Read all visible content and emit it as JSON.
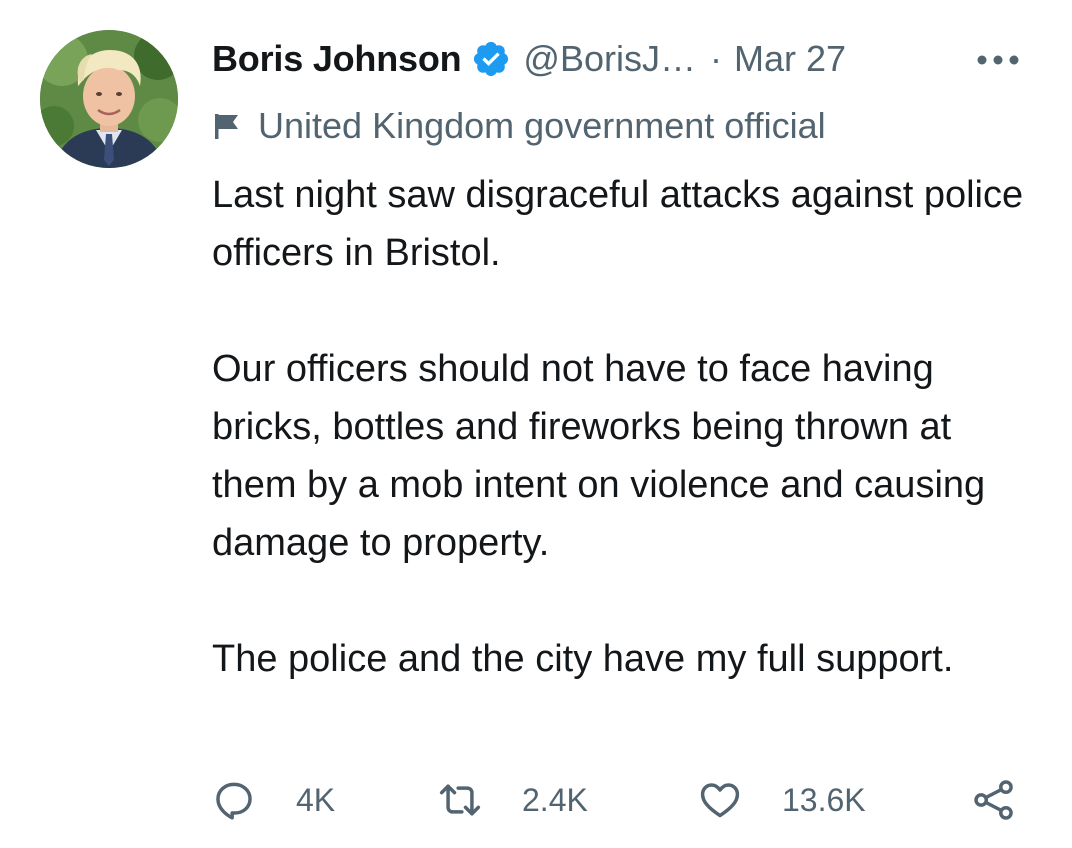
{
  "tweet": {
    "author": {
      "display_name": "Boris Johnson",
      "handle": "@BorisJ…",
      "verified": true
    },
    "separator": "·",
    "timestamp": "Mar 27",
    "label": "United Kingdom government official",
    "paragraphs": [
      "Last night saw disgraceful attacks against police officers in Bristol.",
      "Our officers should not have to face having bricks, bottles and fireworks being thrown at them by a mob intent on violence and causing damage to property.",
      "The police and the city have my full support."
    ],
    "actions": {
      "reply_count": "4K",
      "retweet_count": "2.4K",
      "like_count": "13.6K"
    }
  },
  "icons": {
    "avatar": "avatar-photo",
    "verified": "verified-badge-icon",
    "more": "more-options-icon",
    "label": "flag-icon",
    "reply": "reply-icon",
    "retweet": "retweet-icon",
    "like": "heart-icon",
    "share": "share-icon"
  },
  "colors": {
    "text_primary": "#14171a",
    "text_secondary": "#536471",
    "verified_blue": "#1d9bf0",
    "background": "#ffffff"
  }
}
